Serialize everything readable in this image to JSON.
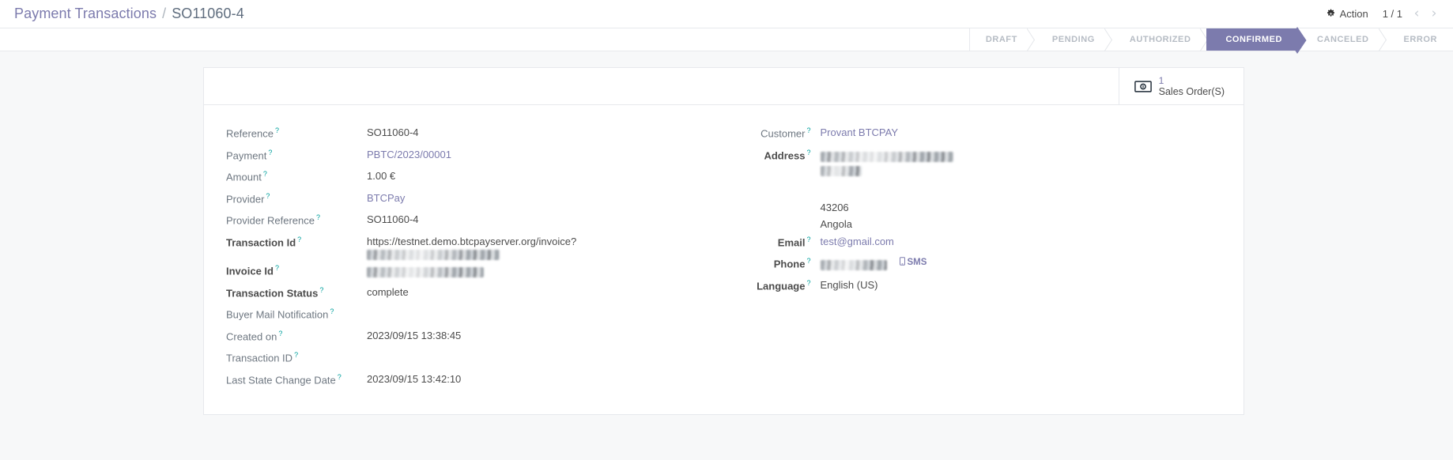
{
  "control_panel": {
    "breadcrumb_root": "Payment Transactions",
    "breadcrumb_separator": "/",
    "breadcrumb_current": "SO11060-4",
    "action_label": "Action",
    "action_icon": "gear-icon",
    "pager_value": "1 / 1",
    "pager_prev_icon": "chevron-left-icon",
    "pager_next_icon": "chevron-right-icon"
  },
  "statusbar": {
    "active": "CONFIRMED",
    "items": [
      {
        "label": "DRAFT"
      },
      {
        "label": "PENDING"
      },
      {
        "label": "AUTHORIZED"
      },
      {
        "label": "CONFIRMED"
      },
      {
        "label": "CANCELED"
      },
      {
        "label": "ERROR"
      }
    ]
  },
  "button_box": {
    "sales_order": {
      "icon": "money-bill-icon",
      "value": "1",
      "label": "Sales Order(S)"
    }
  },
  "form": {
    "left": [
      {
        "label": "Reference",
        "tooltip": "?",
        "value": "SO11060-4",
        "kind": "plain",
        "bold": false
      },
      {
        "label": "Payment",
        "tooltip": "?",
        "value": "PBTC/2023/00001",
        "kind": "link",
        "bold": false
      },
      {
        "label": "Amount",
        "tooltip": "?",
        "value": "1.00 €",
        "kind": "plain",
        "bold": false
      },
      {
        "label": "Provider",
        "tooltip": "?",
        "value": "BTCPay",
        "kind": "link",
        "bold": false
      },
      {
        "label": "Provider Reference",
        "tooltip": "?",
        "value": "SO11060-4",
        "kind": "plain",
        "bold": false
      },
      {
        "label": "Transaction Id",
        "tooltip": "?",
        "value": "https://testnet.demo.btcpayserver.org/invoice?",
        "kind": "plain-redacted",
        "bold": true
      },
      {
        "label": "Invoice Id",
        "tooltip": "?",
        "value": "",
        "kind": "redacted",
        "bold": true
      },
      {
        "label": "Transaction Status",
        "tooltip": "?",
        "value": "complete",
        "kind": "plain",
        "bold": true
      },
      {
        "label": "Buyer Mail Notification",
        "tooltip": "?",
        "value": "",
        "kind": "plain",
        "bold": false
      },
      {
        "label": "Created on",
        "tooltip": "?",
        "value": "2023/09/15 13:38:45",
        "kind": "plain",
        "bold": false
      },
      {
        "label": "Transaction ID",
        "tooltip": "?",
        "value": "",
        "kind": "plain",
        "bold": false
      },
      {
        "label": "Last State Change Date",
        "tooltip": "?",
        "value": "2023/09/15 13:42:10",
        "kind": "plain",
        "bold": false
      }
    ],
    "right": {
      "customer": {
        "label": "Customer",
        "tooltip": "?",
        "value": "Provant BTCPAY"
      },
      "address": {
        "label": "Address",
        "tooltip": "?",
        "zip": "43206",
        "country": "Angola"
      },
      "email": {
        "label": "Email",
        "tooltip": "?",
        "value": "test@gmail.com"
      },
      "phone": {
        "label": "Phone",
        "tooltip": "?",
        "sms_label": "SMS",
        "sms_icon": "mobile-phone-icon"
      },
      "language": {
        "label": "Language",
        "tooltip": "?",
        "value": "English (US)"
      }
    }
  },
  "colors": {
    "accent": "#7c7bad",
    "label": "#6e7781",
    "tooltip": "#00a09d",
    "border": "#e7e9ed",
    "content_bg": "#f7f8f9"
  }
}
